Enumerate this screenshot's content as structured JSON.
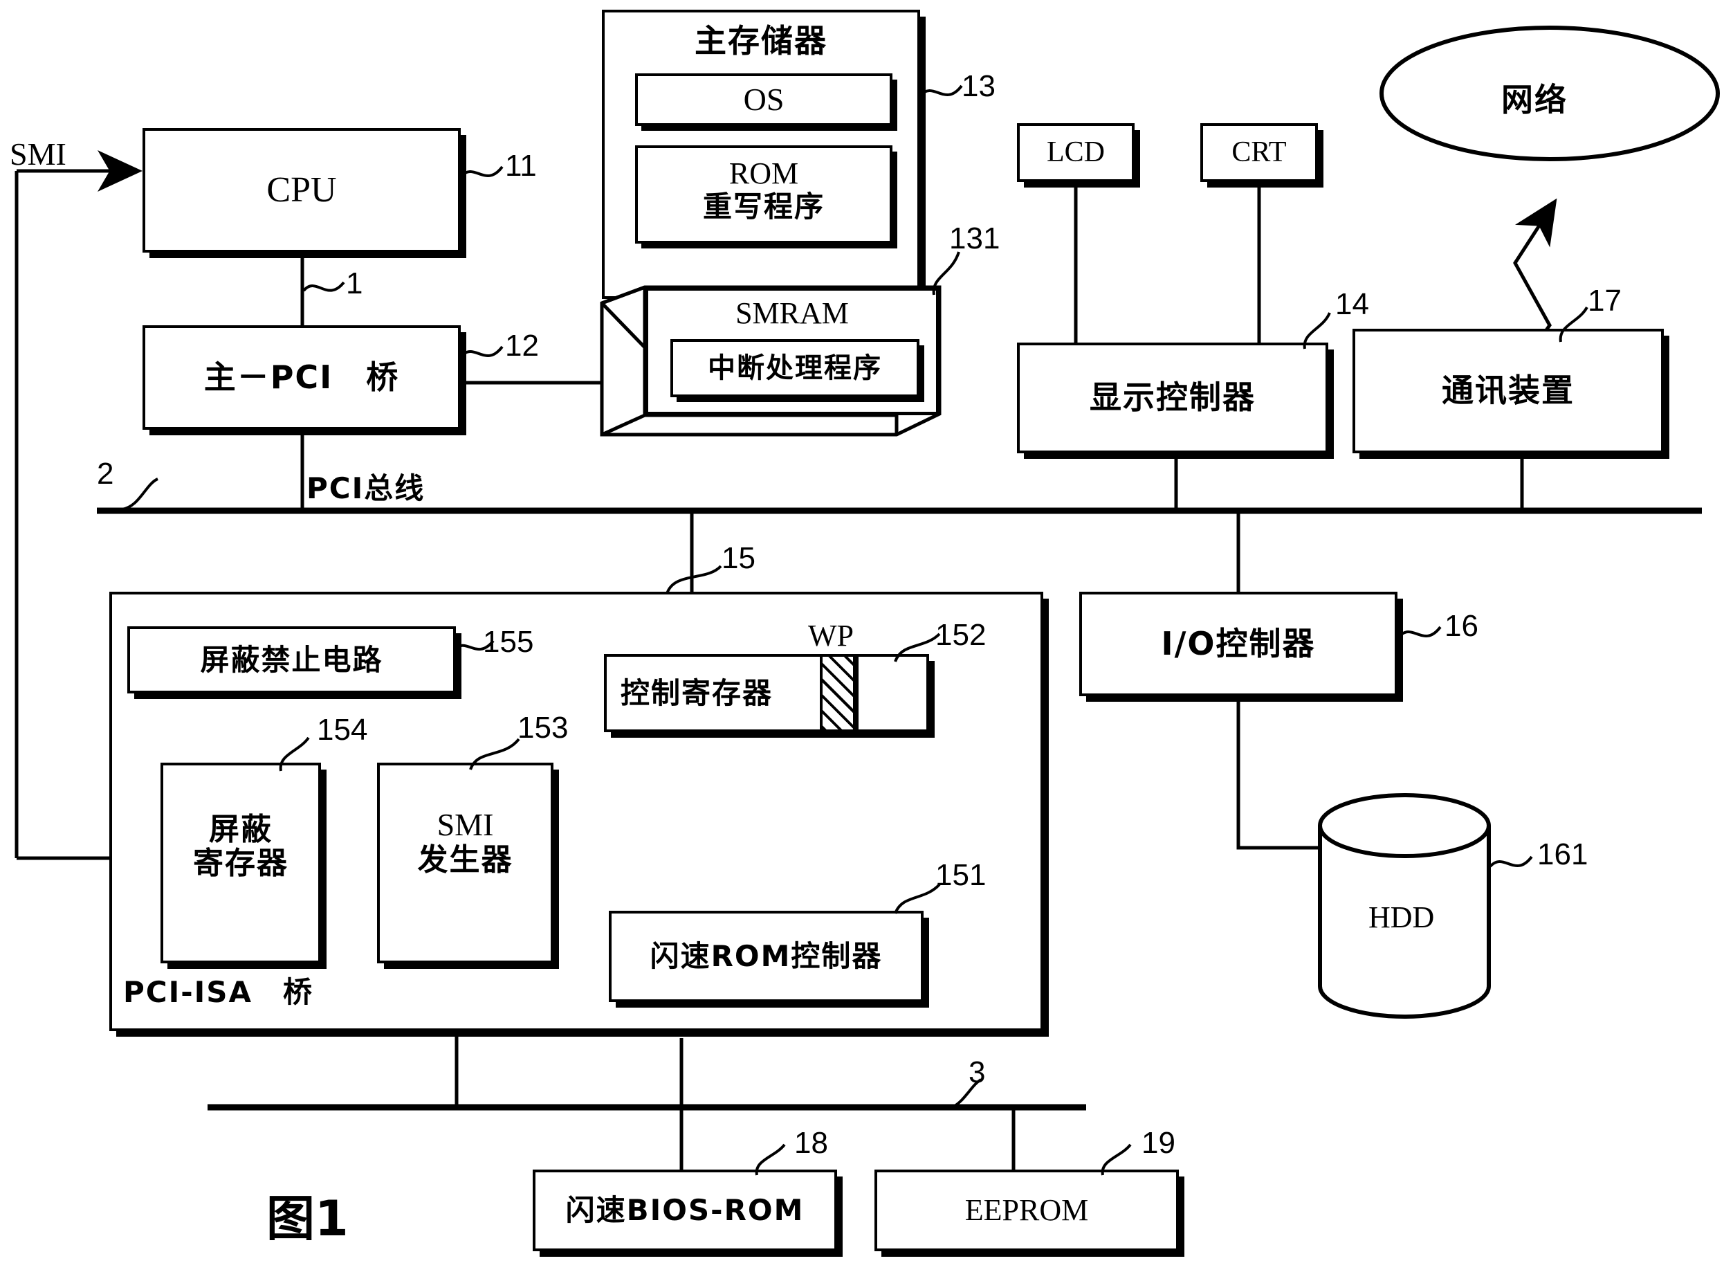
{
  "figure": {
    "caption": "图1"
  },
  "signals": {
    "smi": "SMI"
  },
  "buses": {
    "pci": {
      "label": "PCI总线",
      "ref": "2"
    },
    "isa": {
      "ref": "3"
    },
    "cpu_bridge": {
      "ref": "1"
    }
  },
  "blocks": {
    "cpu": {
      "label": "CPU",
      "ref": "11"
    },
    "host_bridge": {
      "label": "主－PCI　桥",
      "ref": "12"
    },
    "main_memory": {
      "label": "主存储器",
      "ref": "13"
    },
    "os": {
      "label": "OS"
    },
    "rom_rewrite": {
      "line1": "ROM",
      "line2": "重写程序"
    },
    "smram": {
      "label": "SMRAM",
      "ref": "131"
    },
    "int_handler": {
      "label": "中断处理程序"
    },
    "lcd": {
      "label": "LCD"
    },
    "crt": {
      "label": "CRT"
    },
    "display_ctrl": {
      "label": "显示控制器",
      "ref": "14"
    },
    "network": {
      "label": "网络"
    },
    "comm_device": {
      "label": "通讯装置",
      "ref": "17"
    },
    "io_ctrl": {
      "label": "I/O控制器",
      "ref": "16"
    },
    "hdd": {
      "label": "HDD",
      "ref": "161"
    },
    "pci_isa_bridge": {
      "label": "PCI-ISA　桥",
      "ref": "15"
    },
    "mask_inhibit_circuit": {
      "label": "屏蔽禁止电路",
      "ref": "155"
    },
    "mask_register": {
      "line1": "屏蔽",
      "line2": "寄存器",
      "ref": "154"
    },
    "smi_generator": {
      "line1": "SMI",
      "line2": "发生器",
      "ref": "153"
    },
    "control_register": {
      "label": "控制寄存器",
      "ref": "152",
      "bit_label": "WP"
    },
    "flash_rom_ctrl": {
      "label": "闪速ROM控制器",
      "ref": "151"
    },
    "flash_bios_rom": {
      "label": "闪速BIOS-ROM",
      "ref": "18"
    },
    "eeprom": {
      "label": "EEPROM",
      "ref": "19"
    }
  }
}
